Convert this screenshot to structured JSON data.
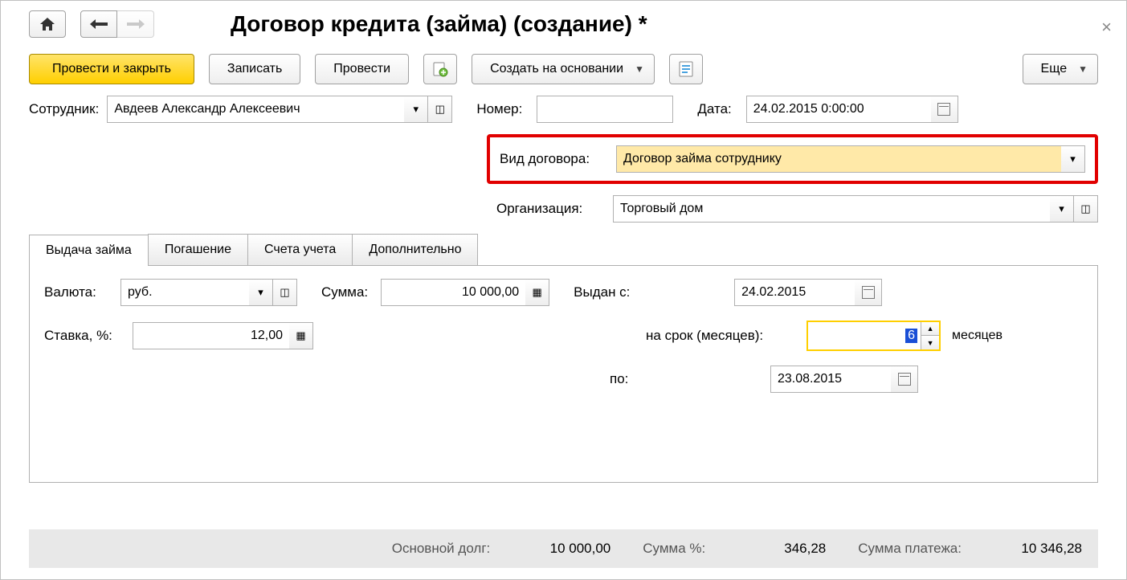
{
  "title": "Договор кредита (займа) (создание) *",
  "toolbar": {
    "post_close": "Провести и закрыть",
    "save": "Записать",
    "post": "Провести",
    "create_based": "Создать на основании",
    "more": "Еще"
  },
  "header": {
    "employee_label": "Сотрудник:",
    "employee_value": "Авдеев Александр Алексеевич",
    "number_label": "Номер:",
    "number_value": "",
    "date_label": "Дата:",
    "date_value": "24.02.2015  0:00:00",
    "contract_type_label": "Вид договора:",
    "contract_type_value": "Договор займа сотруднику",
    "org_label": "Организация:",
    "org_value": "Торговый дом"
  },
  "tabs": {
    "t1": "Выдача займа",
    "t2": "Погашение",
    "t3": "Счета учета",
    "t4": "Дополнительно"
  },
  "loan": {
    "currency_label": "Валюта:",
    "currency_value": "руб.",
    "amount_label": "Сумма:",
    "amount_value": "10 000,00",
    "issued_from_label": "Выдан с:",
    "issued_from_value": "24.02.2015",
    "rate_label": "Ставка, %:",
    "rate_value": "12,00",
    "term_label": "на срок (месяцев):",
    "term_value": "6",
    "term_unit": "месяцев",
    "until_label": "по:",
    "until_value": "23.08.2015"
  },
  "footer": {
    "principal_label": "Основной долг:",
    "principal_value": "10 000,00",
    "interest_label": "Сумма %:",
    "interest_value": "346,28",
    "payment_label": "Сумма платежа:",
    "payment_value": "10 346,28"
  }
}
